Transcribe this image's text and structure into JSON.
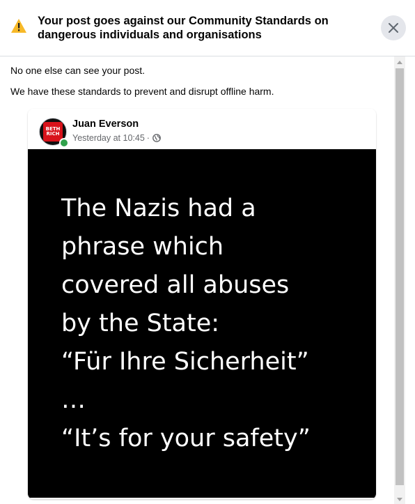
{
  "header": {
    "icon": "warning-triangle-icon",
    "icon_color": "#f7b928",
    "title": "Your post goes against our Community Standards on dangerous individuals and organisations",
    "close_icon": "close-icon"
  },
  "body": {
    "line1": "No one else can see your post.",
    "line2": "We have these standards to prevent and disrupt offline harm."
  },
  "post": {
    "author": "Juan Everson",
    "timestamp": "Yesterday at 10:45",
    "separator": "·",
    "audience_icon": "globe-icon",
    "avatar_text": [
      "BETH",
      "RICH"
    ],
    "online_status_color": "#31a24c",
    "image_text": "The Nazis had a\nphrase which\ncovered all abuses\nby the State:\n“Für Ihre Sicherheit”\n…\n“It’s for your safety”"
  }
}
